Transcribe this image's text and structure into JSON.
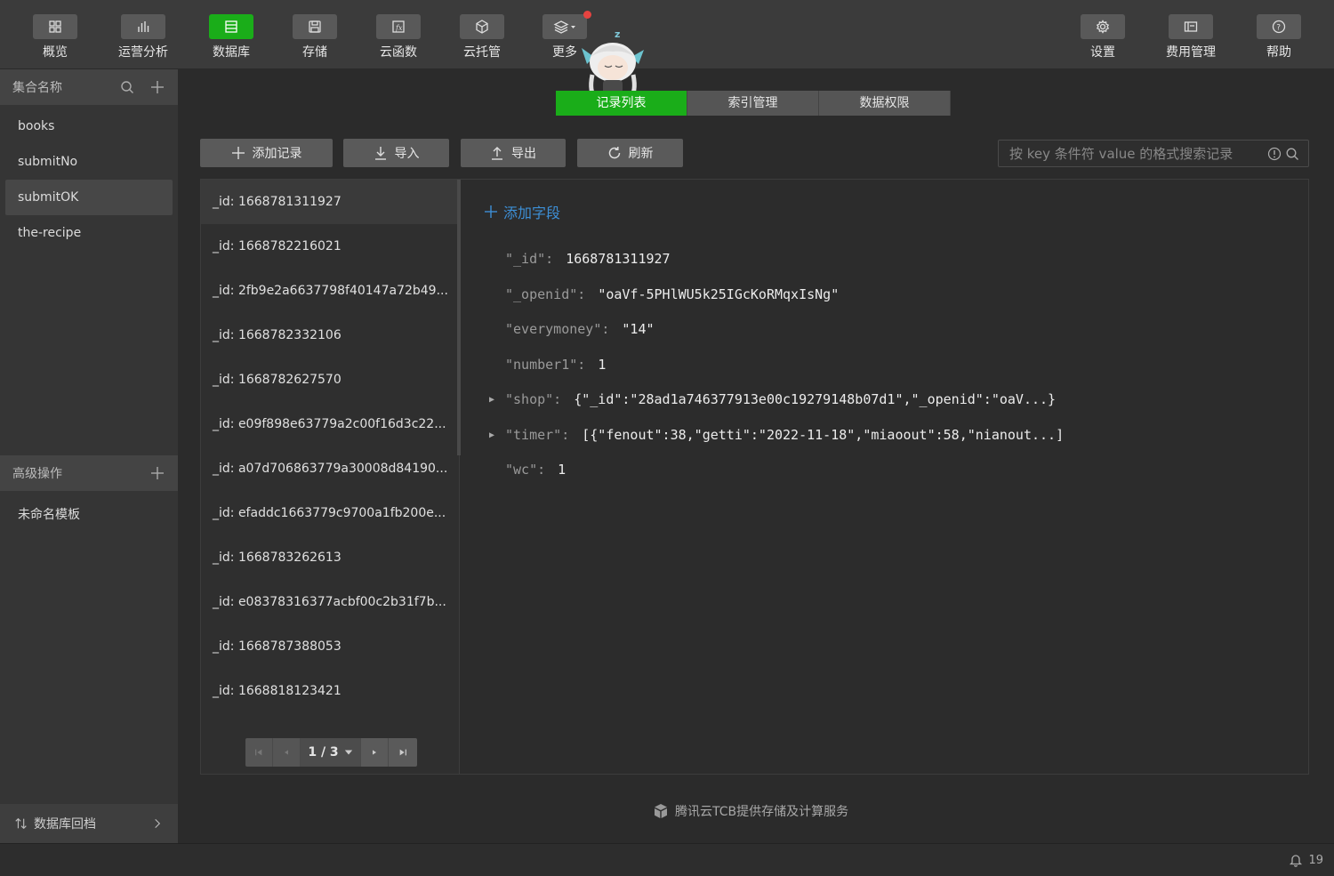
{
  "toolbar": {
    "items": [
      {
        "label": "概览",
        "icon": "overview-icon"
      },
      {
        "label": "运营分析",
        "icon": "chart-icon"
      },
      {
        "label": "数据库",
        "icon": "database-icon"
      },
      {
        "label": "存储",
        "icon": "storage-icon"
      },
      {
        "label": "云函数",
        "icon": "function-icon"
      },
      {
        "label": "云托管",
        "icon": "cube-icon"
      },
      {
        "label": "更多",
        "icon": "layers-icon"
      },
      {
        "label": "设置",
        "icon": "gear-icon"
      },
      {
        "label": "费用管理",
        "icon": "billing-icon"
      },
      {
        "label": "帮助",
        "icon": "help-icon"
      }
    ],
    "active": "数据库",
    "sleep_mark": "z"
  },
  "sidebar": {
    "collection_header": "集合名称",
    "collections": [
      "books",
      "submitNo",
      "submitOK",
      "the-recipe"
    ],
    "active_collection": "submitOK",
    "advanced_header": "高级操作",
    "advanced_items": [
      "未命名模板"
    ],
    "rollback_label": "数据库回档"
  },
  "tabs": [
    "记录列表",
    "索引管理",
    "数据权限"
  ],
  "actions": {
    "add_record": "添加记录",
    "import": "导入",
    "export": "导出",
    "refresh": "刷新"
  },
  "search": {
    "placeholder": "按 key 条件符 value 的格式搜索记录"
  },
  "records": [
    "_id: 1668781311927",
    "_id: 1668782216021",
    "_id: 2fb9e2a6637798f40147a72b49...",
    "_id: 1668782332106",
    "_id: 1668782627570",
    "_id: e09f898e63779a2c00f16d3c22...",
    "_id: a07d706863779a30008d84190...",
    "_id: efaddc1663779c9700a1fb200e...",
    "_id: 1668783262613",
    "_id: e08378316377acbf00c2b31f7b...",
    "_id: 1668787388053",
    "_id: 1668818123421"
  ],
  "pager": {
    "label": "1 / 3"
  },
  "detail": {
    "add_field": "添加字段",
    "fields": [
      {
        "key": "\"_id\":",
        "value": "1668781311927"
      },
      {
        "key": "\"_openid\":",
        "value": "\"oaVf-5PHlWU5k25IGcKoRMqxIsNg\""
      },
      {
        "key": "\"everymoney\":",
        "value": "\"14\""
      },
      {
        "key": "\"number1\":",
        "value": "1"
      },
      {
        "key": "\"shop\":",
        "value": "{\"_id\":\"28ad1a746377913e00c19279148b07d1\",\"_openid\":\"oaV...}"
      },
      {
        "key": "\"timer\":",
        "value": "[{\"fenout\":38,\"getti\":\"2022-11-18\",\"miaoout\":58,\"nianout...]"
      },
      {
        "key": "\"wc\":",
        "value": "1"
      }
    ]
  },
  "footer": {
    "tcb_text": "腾讯云TCB提供存储及计算服务"
  },
  "status": {
    "notifications": "19"
  },
  "colors": {
    "accent": "#1aad19",
    "link": "#3d8fd6"
  }
}
